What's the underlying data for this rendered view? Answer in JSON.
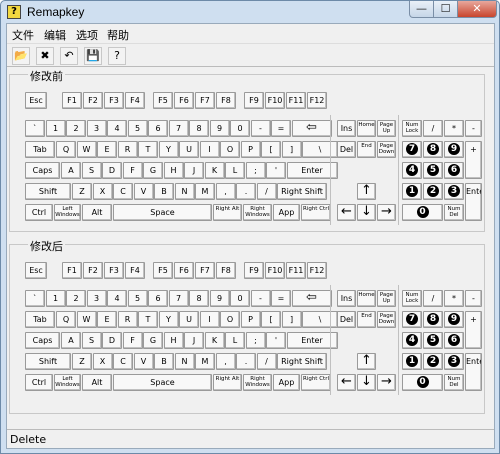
{
  "window": {
    "title": "Remapkey",
    "app_icon": "?",
    "min": "—",
    "max": "☐",
    "close": "✕"
  },
  "menu": [
    "文件",
    "编辑",
    "选项",
    "帮助"
  ],
  "toolbar": [
    {
      "name": "open-icon",
      "glyph": "📂"
    },
    {
      "name": "delete-icon",
      "glyph": "✖"
    },
    {
      "name": "undo-icon",
      "glyph": "↶"
    },
    {
      "name": "save-icon",
      "glyph": "💾"
    },
    {
      "name": "help-icon",
      "glyph": "?"
    }
  ],
  "groups": [
    {
      "title": "修改前"
    },
    {
      "title": "修改后"
    }
  ],
  "keys": {
    "esc": "Esc",
    "fkeys": [
      "F1",
      "F2",
      "F3",
      "F4",
      "F5",
      "F6",
      "F7",
      "F8",
      "F9",
      "F10",
      "F11",
      "F12"
    ],
    "row1": [
      "`",
      "1",
      "2",
      "3",
      "4",
      "5",
      "6",
      "7",
      "8",
      "9",
      "0",
      "-",
      "=",
      "⇦"
    ],
    "row2": [
      "Tab",
      "Q",
      "W",
      "E",
      "R",
      "T",
      "Y",
      "U",
      "I",
      "O",
      "P",
      "[",
      "]",
      "\\"
    ],
    "row3": [
      "Caps",
      "A",
      "S",
      "D",
      "F",
      "G",
      "H",
      "J",
      "K",
      "L",
      ";",
      "'",
      "Enter"
    ],
    "row4": [
      "Shift",
      "Z",
      "X",
      "C",
      "V",
      "B",
      "N",
      "M",
      ",",
      ".",
      "/",
      "Right Shift"
    ],
    "row5": [
      "Ctrl",
      "Left Windows",
      "Alt",
      "Space",
      "Right Alt",
      "Right Windows",
      "App",
      "Right Ctrl"
    ],
    "nav": [
      "Ins",
      "Home",
      "Page Up",
      "Del",
      "End",
      "Page Down"
    ],
    "arrows": [
      "↑",
      "←",
      "↓",
      "→"
    ],
    "numpad_top": [
      "Num Lock",
      "/",
      "*",
      "-"
    ],
    "numpad_digits": [
      "7",
      "8",
      "9",
      "4",
      "5",
      "6",
      "1",
      "2",
      "3"
    ],
    "numpad_plus": "+",
    "numpad_enter": "Enter",
    "numpad_zero": "0",
    "numpad_del": "Num Del"
  },
  "status": "Delete"
}
